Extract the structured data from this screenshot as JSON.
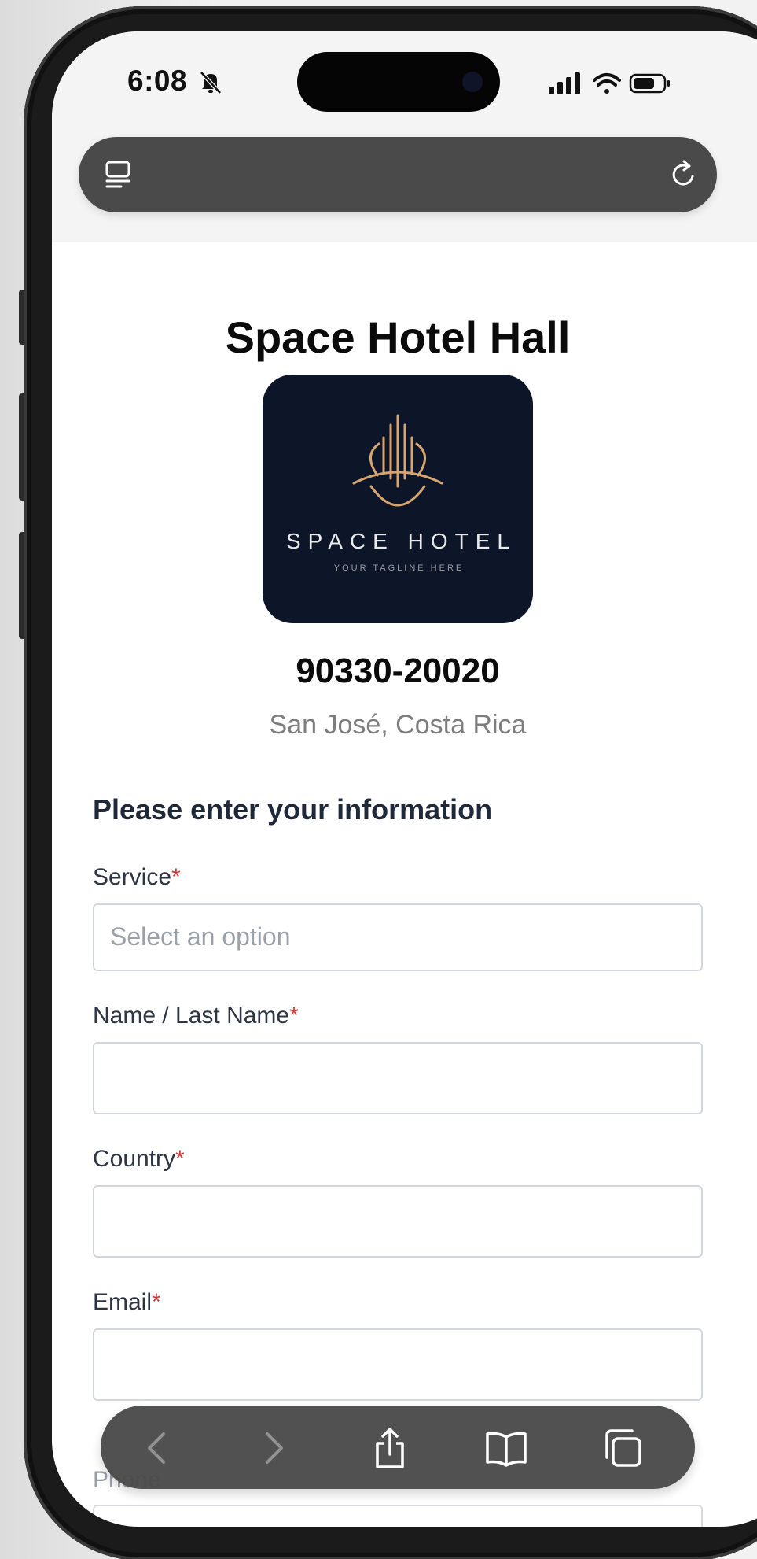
{
  "status_bar": {
    "time": "6:08",
    "icons": [
      "bell-slash-icon",
      "signal-icon",
      "wifi-icon",
      "battery-icon"
    ]
  },
  "browser": {
    "toolbar_icons": [
      "tabs-icon",
      "reload-icon"
    ],
    "bottom_icons": [
      "back-icon",
      "forward-icon",
      "share-icon",
      "bookmarks-icon",
      "tabs-overview-icon"
    ]
  },
  "hotel": {
    "title": "Space Hotel Hall",
    "logo_name": "SPACE HOTEL",
    "logo_tagline": "YOUR TAGLINE HERE",
    "code": "90330-20020",
    "location": "San José, Costa Rica"
  },
  "form": {
    "heading": "Please enter your information",
    "required_mark": "*",
    "fields": {
      "service": {
        "label": "Service",
        "placeholder": "Select an option",
        "value": ""
      },
      "name": {
        "label": "Name / Last Name",
        "value": ""
      },
      "country": {
        "label": "Country",
        "value": ""
      },
      "email": {
        "label": "Email",
        "value": ""
      },
      "phone": {
        "label": "Phone",
        "value": ""
      }
    }
  },
  "colors": {
    "logo_background": "#0d1629",
    "logo_gold": "#d7a56f",
    "required": "#d33b3b",
    "toolbar": "#4a4a4a"
  }
}
